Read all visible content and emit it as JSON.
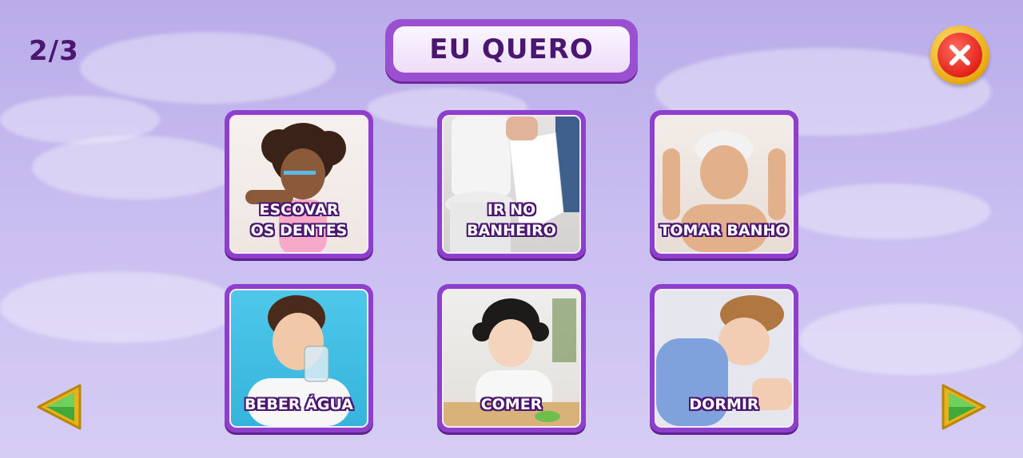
{
  "header": {
    "page_counter": "2/3",
    "title": "EU QUERO"
  },
  "cards": [
    {
      "label": "ESCOVAR\nOS DENTES",
      "image": "child-brushing-teeth"
    },
    {
      "label": "IR NO BANHEIRO",
      "image": "toilet-and-paper-roll"
    },
    {
      "label": "TOMAR BANHO",
      "image": "boy-washing-hair"
    },
    {
      "label": "BEBER ÁGUA",
      "image": "boy-drinking-water"
    },
    {
      "label": "COMER",
      "image": "girl-eating"
    },
    {
      "label": "DORMIR",
      "image": "boy-sleeping"
    }
  ],
  "icons": {
    "close": "close-icon",
    "prev": "left-arrow-icon",
    "next": "right-arrow-icon"
  },
  "colors": {
    "accent": "#9b4fd1",
    "title_text": "#4a1670",
    "close_red": "#e3231b",
    "arrow_green": "#3faa3a",
    "arrow_gold": "#e8b31a"
  }
}
